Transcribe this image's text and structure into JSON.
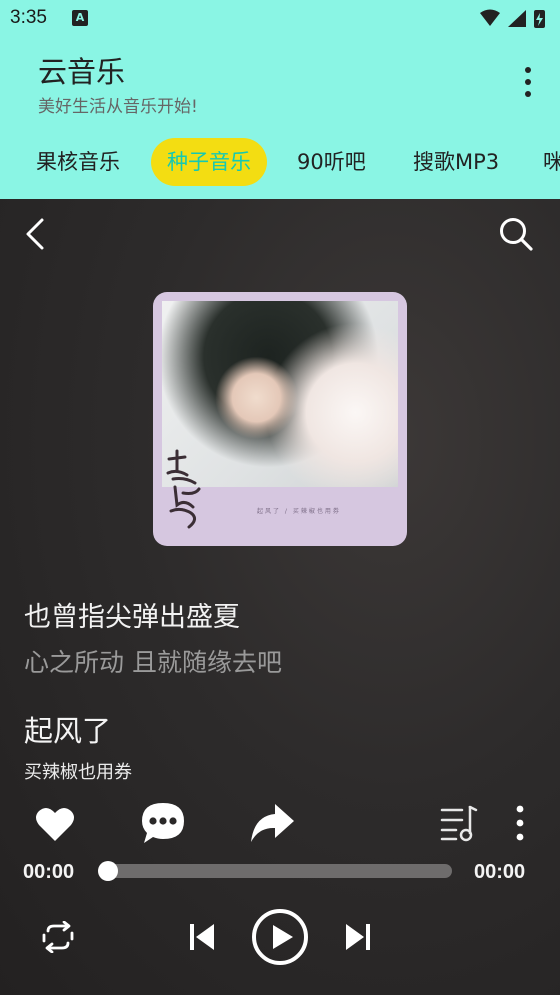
{
  "status_bar": {
    "time": "3:35",
    "notification_badge": "A"
  },
  "app": {
    "title": "云音乐",
    "subtitle": "美好生活从音乐开始!"
  },
  "tabs": [
    {
      "label": "果核音乐",
      "active": false
    },
    {
      "label": "种子音乐",
      "active": true
    },
    {
      "label": "90听吧",
      "active": false
    },
    {
      "label": "搜歌MP3",
      "active": false
    },
    {
      "label": "咪",
      "active": false
    }
  ],
  "player": {
    "lyric_current": "也曾指尖弹出盛夏",
    "lyric_next": "心之所动 且就随缘去吧",
    "song_title": "起风了",
    "artist": "买辣椒也用券",
    "album_art": {
      "script_text": "起风了",
      "caption": "起风了 / 买辣椒也用券"
    },
    "time_elapsed": "00:00",
    "time_total": "00:00",
    "progress": 0
  },
  "icons": {
    "back": "back-arrow-icon",
    "search": "search-icon",
    "like": "heart-icon",
    "comment": "comment-icon",
    "share": "share-icon",
    "playlist": "playlist-icon",
    "more": "more-vertical-icon",
    "repeat": "repeat-icon",
    "previous": "skip-previous-icon",
    "play": "play-icon",
    "next": "skip-next-icon"
  },
  "colors": {
    "header_bg": "#8af5e4",
    "active_tab_bg": "#f3dd12",
    "active_tab_text": "#14c9b3",
    "player_bg": "#2a2828"
  }
}
